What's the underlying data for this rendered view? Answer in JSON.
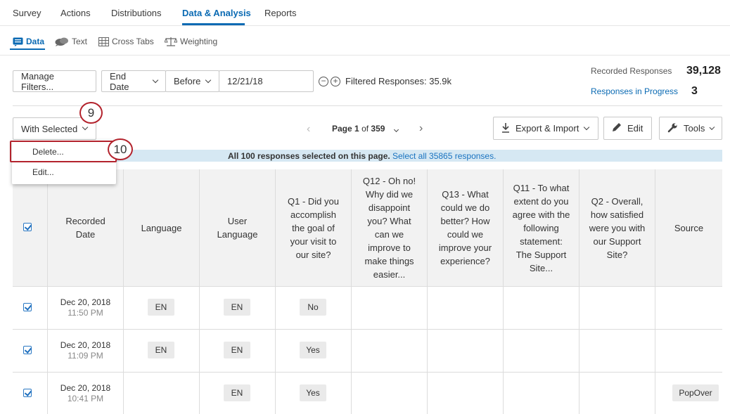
{
  "topnav": {
    "tabs": [
      "Survey",
      "Actions",
      "Distributions",
      "Data & Analysis",
      "Reports"
    ]
  },
  "subnav": {
    "tabs": [
      "Data",
      "Text",
      "Cross Tabs",
      "Weighting"
    ]
  },
  "filters": {
    "manage_label": "Manage Filters...",
    "field_label": "End Date",
    "operator_label": "Before",
    "date_value": "12/21/18",
    "minus_icon": "−",
    "plus_icon": "+",
    "filtered_text": "Filtered Responses: 35.9k"
  },
  "stats": {
    "recorded_label": "Recorded Responses",
    "recorded_value": "39,128",
    "in_progress_label": "Responses in Progress",
    "in_progress_value": "3"
  },
  "toolbar": {
    "with_selected_label": "With Selected",
    "page_prefix": "Page",
    "page_current": "1",
    "page_of": "of",
    "page_total": "359",
    "export_label": "Export & Import",
    "edit_label": "Edit",
    "tools_label": "Tools"
  },
  "dropdown": {
    "delete_label": "Delete...",
    "edit_label": "Edit..."
  },
  "markers": {
    "step_9": "9",
    "step_10": "10"
  },
  "selection": {
    "text": "All 100 responses selected on this page.",
    "link": "Select all 35865 responses."
  },
  "table": {
    "headers": [
      "Recorded Date",
      "Language",
      "User Language",
      "Q1 - Did you accomplish the goal of your visit to our site?",
      "Q12 - Oh no! Why did we disappoint you? What can we improve to make things easier...",
      "Q13 - What could we do better? How could we improve your experience?",
      "Q11 - To what extent do you agree with the following statement: The Support Site...",
      "Q2 - Overall, how satisfied were you with our Support Site?",
      "Source"
    ],
    "rows": [
      {
        "date": "Dec 20, 2018",
        "time": "11:50 PM",
        "language": "EN",
        "user_language": "EN",
        "q1": "No",
        "source": ""
      },
      {
        "date": "Dec 20, 2018",
        "time": "11:09 PM",
        "language": "EN",
        "user_language": "EN",
        "q1": "Yes",
        "source": ""
      },
      {
        "date": "Dec 20, 2018",
        "time": "10:41 PM",
        "language": "",
        "user_language": "EN",
        "q1": "Yes",
        "source": "PopOver"
      }
    ]
  },
  "colors": {
    "accent": "#0a6ab3",
    "annotation": "#b3232d",
    "selection_bar": "#d6e8f3"
  }
}
